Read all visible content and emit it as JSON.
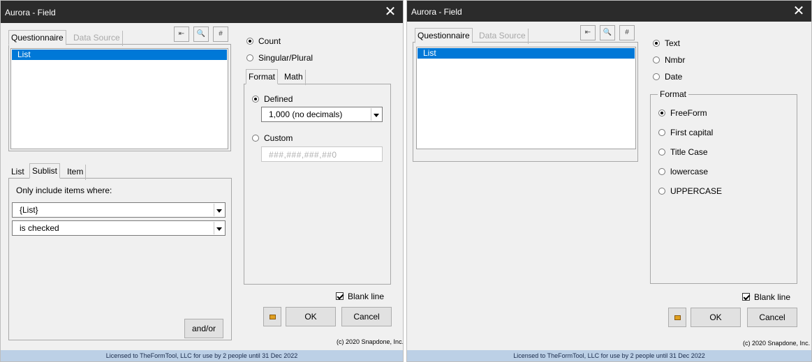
{
  "left": {
    "title": "Aurora - Field",
    "close_glyph": "✕",
    "tabs": {
      "questionnaire": "Questionnaire",
      "data_source": "Data Source"
    },
    "toolbar": {
      "back": "⇤",
      "search": "🔍",
      "hash": "#"
    },
    "list_item": "List",
    "lower_tabs": {
      "list": "List",
      "sublist": "Sublist",
      "item": "Item"
    },
    "filter_label": "Only include items where:",
    "combo1": "{List}",
    "combo2": "is checked",
    "andor": "and/or",
    "radios": {
      "count": "Count",
      "singular": "Singular/Plural"
    },
    "format_tabs": {
      "format": "Format",
      "math": "Math"
    },
    "defined": "Defined",
    "defined_value": "1,000 (no decimals)",
    "custom": "Custom",
    "custom_placeholder": "###,###,###,##0",
    "blank_line": "Blank line",
    "ok": "OK",
    "cancel": "Cancel",
    "copyright": "(c) 2020 Snapdone, Inc.",
    "license": "Licensed to TheFormTool, LLC for use by 2 people until 31 Dec 2022"
  },
  "right": {
    "title": "Aurora - Field",
    "close_glyph": "✕",
    "tabs": {
      "questionnaire": "Questionnaire",
      "data_source": "Data Source"
    },
    "toolbar": {
      "back": "⇤",
      "search": "🔍",
      "hash": "#"
    },
    "list_item": "List",
    "type_radios": {
      "text": "Text",
      "nmbr": "Nmbr",
      "date": "Date"
    },
    "format_group": "Format",
    "format_options": [
      "FreeForm",
      "First capital",
      "Title Case",
      "lowercase",
      "UPPERCASE"
    ],
    "blank_line": "Blank line",
    "ok": "OK",
    "cancel": "Cancel",
    "copyright": "(c) 2020 Snapdone, Inc.",
    "license": "Licensed to TheFormTool, LLC for use by 2 people until 31 Dec 2022"
  }
}
